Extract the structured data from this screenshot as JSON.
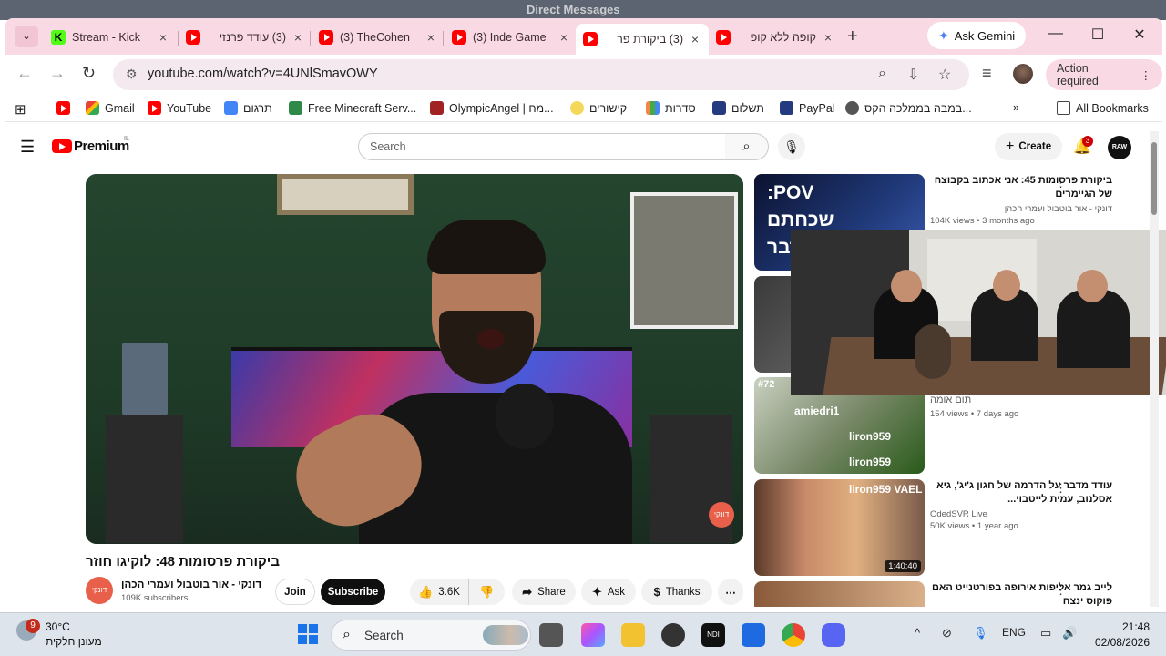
{
  "window": {
    "back_title": "Direct Messages"
  },
  "tabs": [
    {
      "label": "Stream - Kick",
      "icon": "kick-icon"
    },
    {
      "label": "(3) עודד פרנזי",
      "icon": "youtube-icon"
    },
    {
      "label": "(3) TheCohen",
      "icon": "youtube-icon"
    },
    {
      "label": "(3) Inde Game",
      "icon": "youtube-icon"
    },
    {
      "label": "(3) ביקורת פר",
      "icon": "youtube-icon",
      "active": true
    },
    {
      "label": "קופה ללא קופ",
      "icon": "youtube-icon"
    }
  ],
  "gemini_label": "Ask Gemini",
  "address": {
    "url": "youtube.com/watch?v=4UNlSmavOWY"
  },
  "action_required": "Action required",
  "bookmarks": [
    {
      "label": "",
      "icon": "youtube-icon"
    },
    {
      "label": "Gmail",
      "icon": "gmail-icon"
    },
    {
      "label": "YouTube",
      "icon": "youtube-icon"
    },
    {
      "label": "תרגום",
      "icon": "translate-icon"
    },
    {
      "label": "Free Minecraft Serv...",
      "icon": "minecraft-icon"
    },
    {
      "label": "OlympicAngel | מח...",
      "icon": "olympic-icon"
    },
    {
      "label": "קישורים",
      "icon": "sun-icon"
    },
    {
      "label": "סדרות",
      "icon": "series-icon"
    },
    {
      "label": "תשלום",
      "icon": "paypal-icon"
    },
    {
      "label": "PayPal",
      "icon": "paypal-icon"
    },
    {
      "label": "במבה בממלכה הקס...",
      "icon": "globe-icon"
    }
  ],
  "all_bookmarks": "All Bookmarks",
  "youtube": {
    "brand": "Premium",
    "region": "IL",
    "search_placeholder": "Search",
    "create_label": "Create",
    "notif_count": "3",
    "avatar_text": "RAW"
  },
  "video": {
    "title": "ביקורת פרסומות 48: לוקיגו חוזר",
    "channel": "דונקי - אור בוטבול ועמרי הכהן",
    "subscribers": "109K subscribers",
    "join": "Join",
    "subscribe": "Subscribe",
    "likes": "3.6K",
    "share": "Share",
    "ask": "Ask",
    "thanks": "Thanks",
    "logo_text": "דונקי"
  },
  "related": [
    {
      "title": "ביקורת פרסומות 45: אני אכתוב בקבוצה של הגיימרים",
      "channel": "דונקי - אור בוטבול ועמרי הכהן",
      "views": "104K views • 3 months ago",
      "thumb_text": "POV: שכחתם לדבר"
    },
    {
      "title": "",
      "channel": "",
      "views": "",
      "thumb_text": ""
    },
    {
      "title": "תום אומה",
      "channel": "",
      "views": "154 views • 7 days ago",
      "thumb_text": "#72"
    },
    {
      "title": "עודד מדבר על הדרמה של חגון ג'יג', גיא אסלנוב, עמית לייטבוי...",
      "channel": "OdedSVR Live",
      "views": "50K views • 1 year ago",
      "duration": "1:40:40"
    },
    {
      "title": "לייב גמר אליפות אירופה בפורטנייט האם פוקוס ינצח",
      "channel": "",
      "views": ""
    }
  ],
  "overlay_lines": [
    "amiedri1",
    "liron959",
    "liron959",
    "liron959 VAEL"
  ],
  "taskbar": {
    "temp": "30°C",
    "weather": "מעונן חלקית",
    "weather_badge": "9",
    "search": "Search",
    "lang": "ENG",
    "time": "21:48",
    "date": "02/08/2026"
  }
}
